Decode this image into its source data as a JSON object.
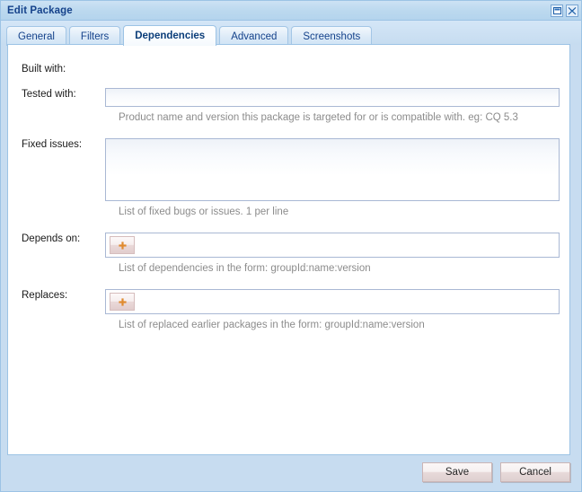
{
  "window": {
    "title": "Edit Package",
    "controls": [
      {
        "name": "restore-button",
        "icon": "restore-icon"
      },
      {
        "name": "close-button",
        "icon": "close-icon"
      }
    ]
  },
  "tabs": [
    {
      "label": "General",
      "active": false
    },
    {
      "label": "Filters",
      "active": false
    },
    {
      "label": "Dependencies",
      "active": true
    },
    {
      "label": "Advanced",
      "active": false
    },
    {
      "label": "Screenshots",
      "active": false
    }
  ],
  "form": {
    "built_with": {
      "label": "Built with:"
    },
    "tested_with": {
      "label": "Tested with:",
      "value": "",
      "placeholder": "",
      "hint": "Product name and version this package is targeted for or is compatible with. eg: CQ 5.3"
    },
    "fixed_issues": {
      "label": "Fixed issues:",
      "value": "",
      "placeholder": "",
      "hint": "List of fixed bugs or issues. 1 per line"
    },
    "depends_on": {
      "label": "Depends on:",
      "add_label": "+",
      "hint": "List of dependencies in the form: groupId:name:version"
    },
    "replaces": {
      "label": "Replaces:",
      "add_label": "+",
      "hint": "List of replaced earlier packages in the form: groupId:name:version"
    }
  },
  "footer": {
    "save_label": "Save",
    "cancel_label": "Cancel"
  },
  "colors": {
    "title_text": "#15428b",
    "window_bg": "#c7dcf0",
    "panel_bg": "#ffffff",
    "border": "#9cc3e5",
    "hint_text": "#8c8c8c",
    "plus_glyph": "#e08a2e"
  }
}
